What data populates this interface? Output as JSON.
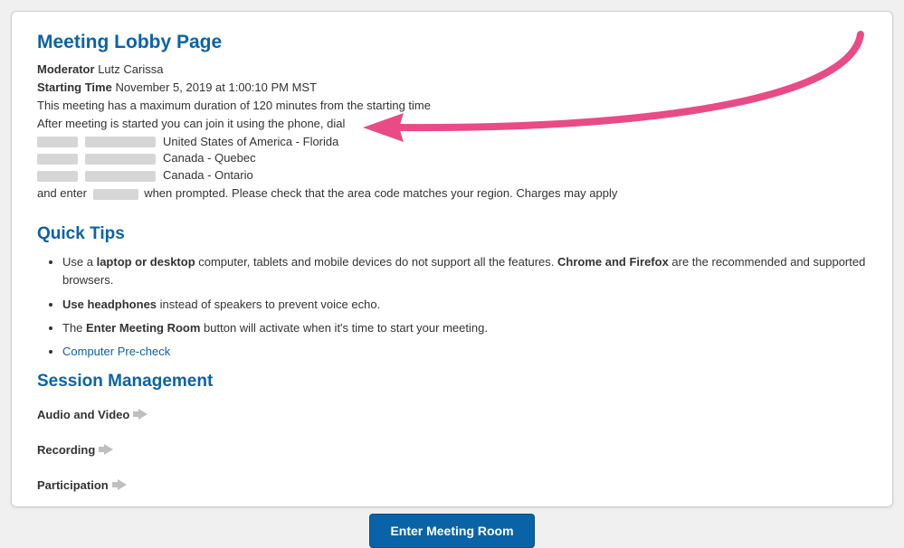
{
  "header": {
    "title": "Meeting Lobby Page",
    "moderator_label": "Moderator",
    "moderator_value": "Lutz Carissa",
    "start_label": "Starting Time",
    "start_value": "November 5, 2019 at 1:00:10 PM MST",
    "duration_note": "This meeting has a maximum duration of 120 minutes from the starting time",
    "dial_intro": "After meeting is started you can join it using the phone, dial",
    "dial_regions": [
      "United States of America - Florida",
      "Canada - Quebec",
      "Canada - Ontario"
    ],
    "pin_prefix": "and enter",
    "pin_suffix": "when prompted. Please check that the area code matches your region. Charges may apply"
  },
  "tips": {
    "title": "Quick Tips",
    "item1_a": "Use a ",
    "item1_b": "laptop or desktop",
    "item1_c": " computer, tablets and mobile devices do not support all the features. ",
    "item1_d": "Chrome and Firefox",
    "item1_e": " are the recommended and supported browsers.",
    "item2_a": "Use headphones",
    "item2_b": " instead of speakers to prevent voice echo.",
    "item3_a": "The ",
    "item3_b": "Enter Meeting Room",
    "item3_c": " button will activate when it's time to start your meeting.",
    "item4_link": "Computer Pre-check"
  },
  "session": {
    "title": "Session Management",
    "items": [
      "Audio and Video",
      "Recording",
      "Participation"
    ]
  },
  "actions": {
    "enter_label": "Enter Meeting Room"
  }
}
